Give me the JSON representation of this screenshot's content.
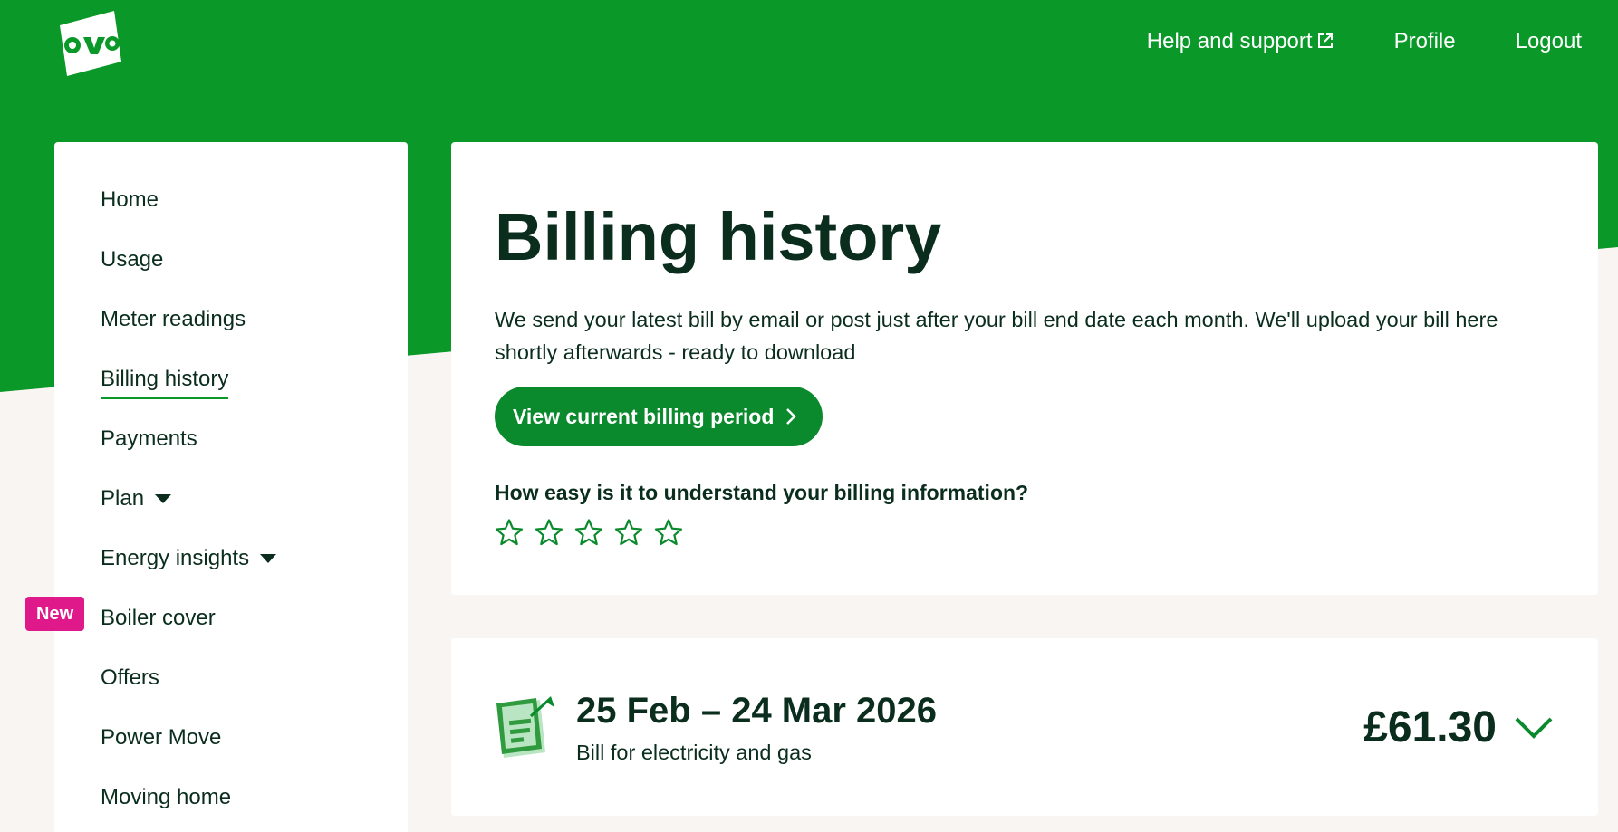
{
  "colors": {
    "brand_green": "#0a9828",
    "button_green": "#0a8a2c",
    "text_dark": "#0a2d1e",
    "badge_pink": "#e0198a",
    "page_bg": "#f8f5f2"
  },
  "header": {
    "logo_alt": "ovo",
    "nav": [
      {
        "label": "Help and support",
        "icon": "external-link-icon"
      },
      {
        "label": "Profile"
      },
      {
        "label": "Logout"
      }
    ]
  },
  "sidebar": {
    "items": [
      {
        "label": "Home"
      },
      {
        "label": "Usage"
      },
      {
        "label": "Meter readings"
      },
      {
        "label": "Billing history",
        "active": true
      },
      {
        "label": "Payments"
      },
      {
        "label": "Plan",
        "icon": "caret-down-icon"
      },
      {
        "label": "Energy insights",
        "icon": "caret-down-icon"
      },
      {
        "label": "Boiler cover",
        "badge": "New"
      },
      {
        "label": "Offers"
      },
      {
        "label": "Power Move"
      },
      {
        "label": "Moving home"
      }
    ]
  },
  "main": {
    "title": "Billing history",
    "intro": "We send your latest bill by email or post just after your bill end date each month. We'll upload your bill here shortly afterwards - ready to download",
    "primary_button": "View current billing period",
    "feedback_question": "How easy is it to understand your billing information?",
    "rating": {
      "max": 5,
      "value": 0
    },
    "bills": [
      {
        "period": "25 Feb – 24 Mar 2026",
        "description": "Bill for electricity and gas",
        "amount": "£61.30",
        "icon": "bill-document-icon",
        "toggle_icon": "chevron-down-icon"
      }
    ]
  }
}
